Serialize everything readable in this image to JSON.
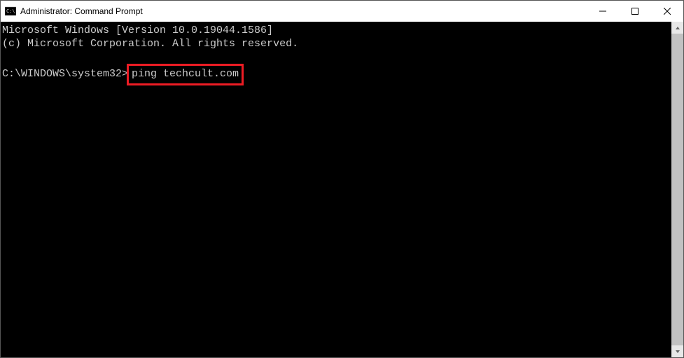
{
  "window": {
    "title": "Administrator: Command Prompt"
  },
  "terminal": {
    "line1": "Microsoft Windows [Version 10.0.19044.1586]",
    "line2": "(c) Microsoft Corporation. All rights reserved.",
    "prompt": "C:\\WINDOWS\\system32>",
    "command": "ping techcult.com"
  }
}
